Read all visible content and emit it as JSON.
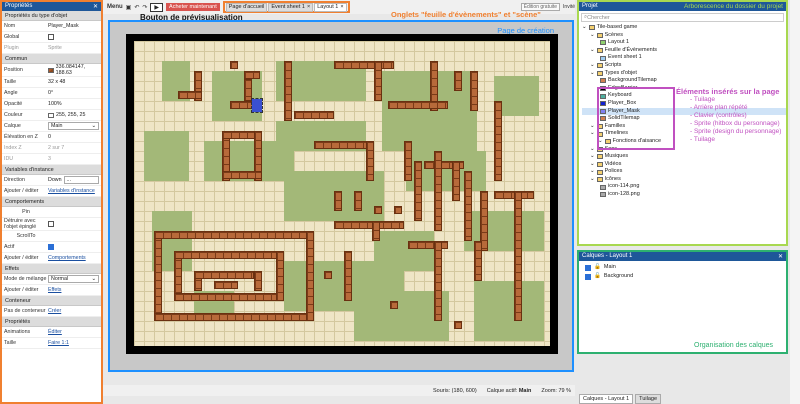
{
  "properties": {
    "header": "Propriétés",
    "rows": [
      {
        "type": "sec",
        "label": "Propriétés du type d'objet"
      },
      {
        "type": "row",
        "k": "Nom",
        "v": "Player_Mask"
      },
      {
        "type": "row",
        "k": "Global",
        "v": "",
        "chk": false
      },
      {
        "type": "row",
        "k": "Plugin",
        "v": "Sprite",
        "dim": true
      },
      {
        "type": "sec",
        "label": "Commun"
      },
      {
        "type": "row",
        "k": "Position",
        "v": "336.084147, 188.63"
      },
      {
        "type": "row",
        "k": "Taille",
        "v": "32 x 48"
      },
      {
        "type": "row",
        "k": "Angle",
        "v": "0°"
      },
      {
        "type": "row",
        "k": "Opacité",
        "v": "100%"
      },
      {
        "type": "row",
        "k": "Couleur",
        "v": "255, 255, 25"
      },
      {
        "type": "row",
        "k": "Calque",
        "v": "Main",
        "sel": true
      },
      {
        "type": "row",
        "k": "Élévation en Z",
        "v": "0"
      },
      {
        "type": "row",
        "k": "Index Z",
        "v": "2 sur 7",
        "dim": true
      },
      {
        "type": "row",
        "k": "IDU",
        "v": "3",
        "dim": true
      },
      {
        "type": "sec",
        "label": "Variables d'instance"
      },
      {
        "type": "row",
        "k": "Direction",
        "v": "Down"
      },
      {
        "type": "row",
        "k": "Ajouter / éditer",
        "v": "Variables d'instance",
        "link": true
      },
      {
        "type": "sec",
        "label": "Comportements"
      },
      {
        "type": "row",
        "k": "Pin",
        "v": "",
        "center": true
      },
      {
        "type": "row",
        "k": "Détruire avec l'objet épinglé",
        "v": "",
        "chk": false
      },
      {
        "type": "row",
        "k": "ScrollTo",
        "v": "",
        "center": true
      },
      {
        "type": "row",
        "k": "Actif",
        "v": "",
        "chk": true
      },
      {
        "type": "row",
        "k": "Ajouter / éditer",
        "v": "Comportements",
        "link": true
      },
      {
        "type": "sec",
        "label": "Effets"
      },
      {
        "type": "row",
        "k": "Mode de mélange",
        "v": "Normal",
        "sel": true
      },
      {
        "type": "row",
        "k": "Ajouter / éditer",
        "v": "Effets",
        "link": true
      },
      {
        "type": "sec",
        "label": "Conteneur"
      },
      {
        "type": "row",
        "k": "Pas de conteneur",
        "v": "Créer",
        "link": true
      },
      {
        "type": "sec",
        "label": "Propriétés"
      },
      {
        "type": "row",
        "k": "Animations",
        "v": "Éditer",
        "link": true
      },
      {
        "type": "row",
        "k": "Taille",
        "v": "Faire 1:1",
        "link": true
      }
    ]
  },
  "toolbar": {
    "menu": "Menu",
    "buy": "Acheter maintenant",
    "play": "▶",
    "tabs": [
      "Page d'accueil",
      "Event sheet 1",
      "Layout 1"
    ],
    "active_tab": 2,
    "edition": "Édition gratuite",
    "mode": "Invité"
  },
  "annotations": {
    "preview": "Bouton de prévisualisation",
    "tabs": "Onglets \"feuille d'évènements\" et \"scène\"",
    "creation": "Page de création",
    "project_tree": "Arborescence du dossier du projet",
    "elements_title": "Éléments insérés sur la page",
    "elements": [
      "- Tuilage",
      "- Arrière plan répété",
      "- Clavier (contrôles)",
      "- Sprite (hitbox du personnage)",
      "- Sprite (design du personnage)",
      "- Tuilage"
    ],
    "layers": "Organisation des calques"
  },
  "status": {
    "mouse": "Souris: (180, 600)",
    "layer_label": "Calque actif:",
    "layer": "Main",
    "zoom": "Zoom: 79 %"
  },
  "project": {
    "header": "Projet",
    "search_placeholder": "Chercher",
    "tree": [
      {
        "d": 0,
        "t": "Tile-based game",
        "ic": "folder"
      },
      {
        "d": 1,
        "t": "Scènes",
        "ic": "folder"
      },
      {
        "d": 2,
        "t": "Layout 1",
        "ic": "layout"
      },
      {
        "d": 1,
        "t": "Feuille d'Évènements",
        "ic": "folder"
      },
      {
        "d": 2,
        "t": "Event sheet 1",
        "ic": "sheet"
      },
      {
        "d": 1,
        "t": "Scripts",
        "ic": "folder"
      },
      {
        "d": 1,
        "t": "Types d'objet",
        "ic": "folder"
      },
      {
        "d": 2,
        "t": "BackgroundTilemap",
        "ic": "tile"
      },
      {
        "d": 2,
        "t": "EdgeBarrier",
        "ic": "black"
      },
      {
        "d": 2,
        "t": "Keyboard",
        "ic": "kb"
      },
      {
        "d": 2,
        "t": "Player_Box",
        "ic": "blue"
      },
      {
        "d": 2,
        "t": "Player_Mask",
        "ic": "sprite",
        "selected": true
      },
      {
        "d": 2,
        "t": "SolidTilemap",
        "ic": "tile"
      },
      {
        "d": 1,
        "t": "Familles",
        "ic": "folder"
      },
      {
        "d": 1,
        "t": "Timelines",
        "ic": "folder"
      },
      {
        "d": 2,
        "t": "Fonctions d'aisance",
        "ic": "folder"
      },
      {
        "d": 1,
        "t": "Sons",
        "ic": "folder"
      },
      {
        "d": 1,
        "t": "Musiques",
        "ic": "folder"
      },
      {
        "d": 1,
        "t": "Vidéos",
        "ic": "folder"
      },
      {
        "d": 1,
        "t": "Polices",
        "ic": "folder"
      },
      {
        "d": 1,
        "t": "Icônes",
        "ic": "folder"
      },
      {
        "d": 2,
        "t": "icon-114.png",
        "ic": "gear"
      },
      {
        "d": 2,
        "t": "icon-128.png",
        "ic": "gear"
      }
    ]
  },
  "layers": {
    "header": "Calques - Layout 1",
    "items": [
      {
        "name": "Main"
      },
      {
        "name": "Background"
      }
    ]
  },
  "bottom_tabs": [
    "Calques - Layout 1",
    "Tuilage"
  ],
  "colors": {
    "properties_border": "#f08030",
    "canvas_border": "#1e90ff",
    "project_border": "#a8d850",
    "layers_border": "#2db070",
    "elements_border": "#c050c0"
  }
}
